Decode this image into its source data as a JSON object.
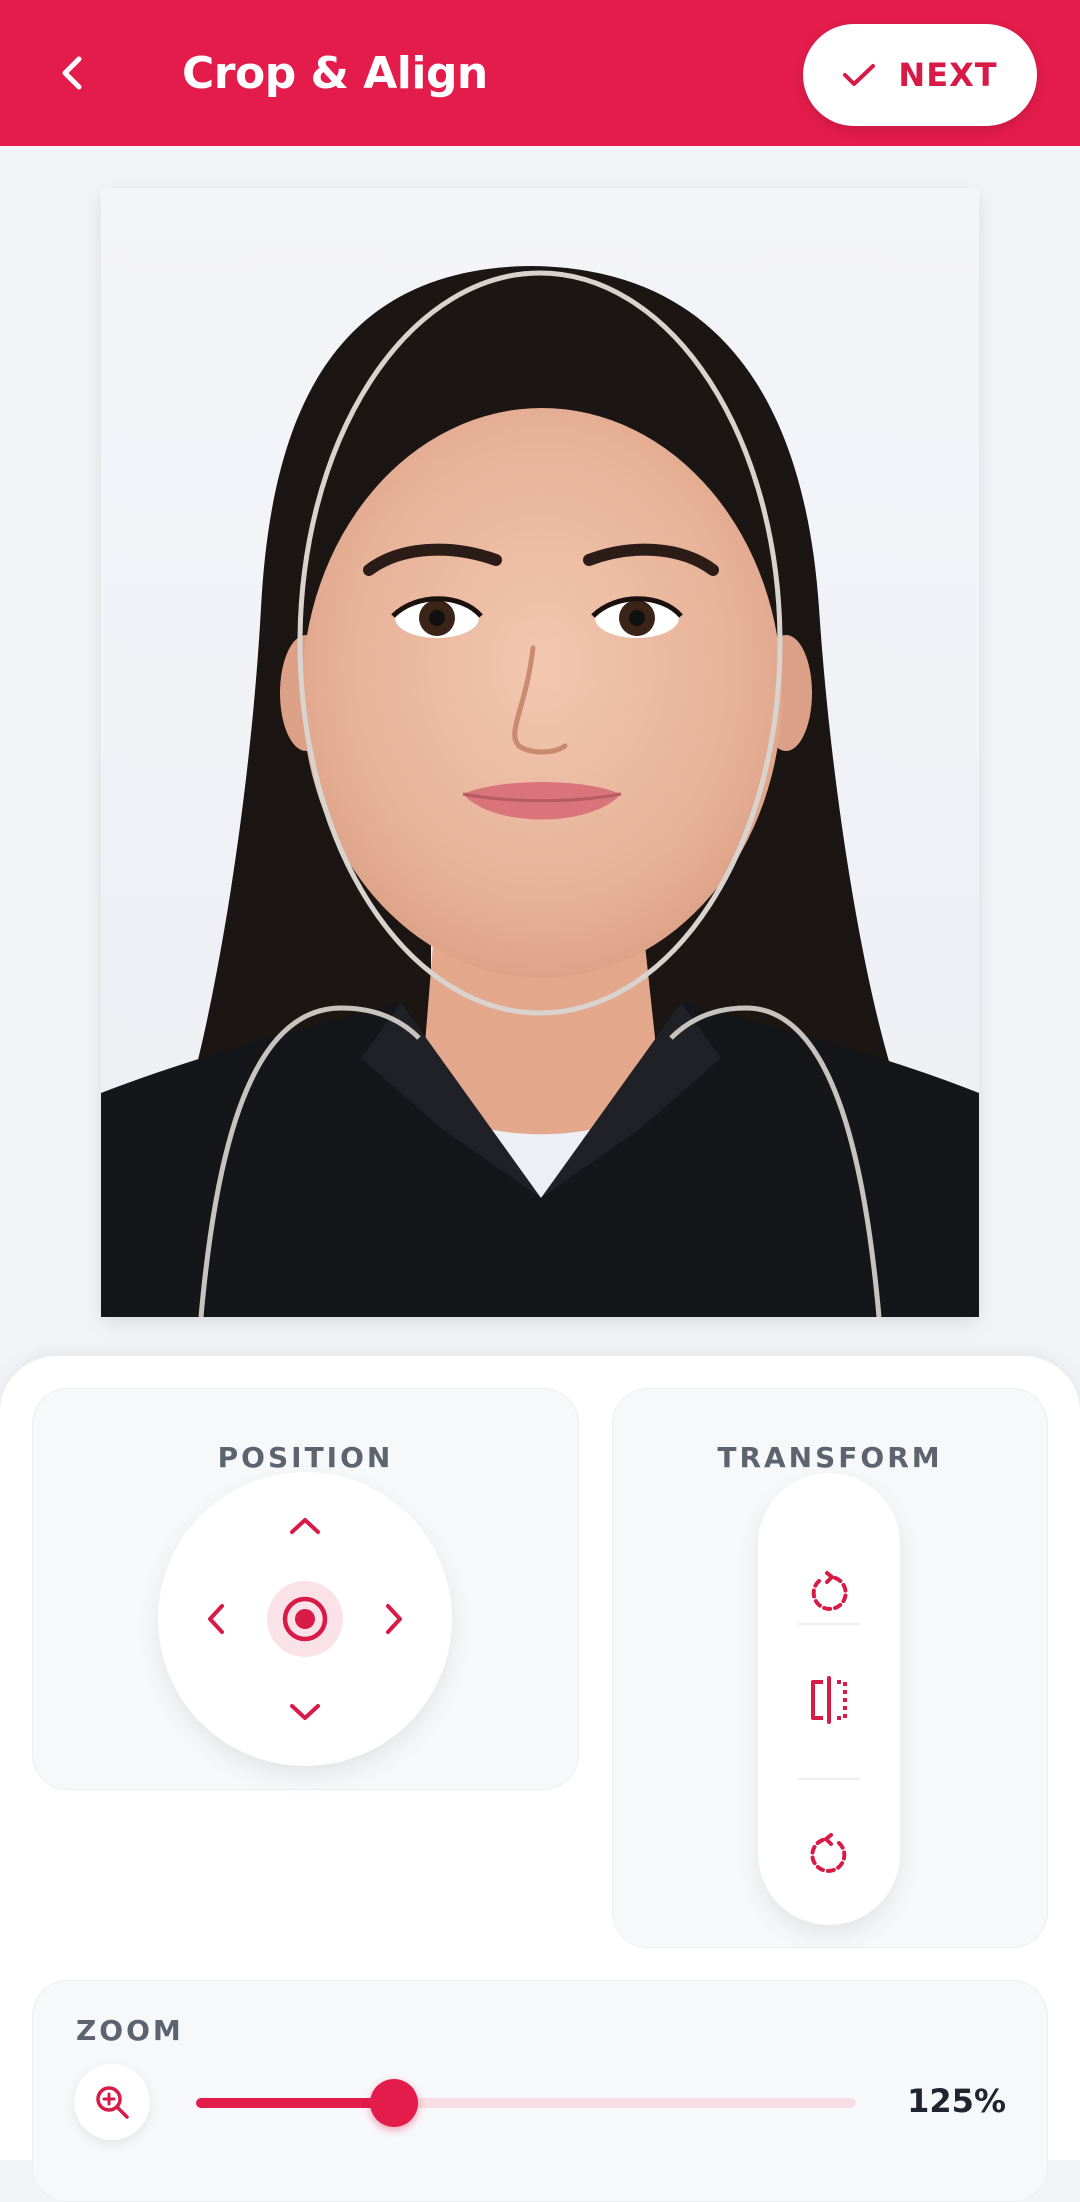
{
  "app_bar": {
    "title": "Crop & Align",
    "back_icon": "chevron-left-icon",
    "next_label": "NEXT",
    "next_icon": "check-icon"
  },
  "colors": {
    "accent": "#e31c4b",
    "accent_light": "#fbe1e8",
    "card_bg": "#f7f8fa",
    "guide_line": "#d9d3cf"
  },
  "position": {
    "label": "POSITION",
    "icons": [
      "chevron-up-icon",
      "chevron-left-icon",
      "target-icon",
      "chevron-right-icon",
      "chevron-down-icon"
    ]
  },
  "transform": {
    "label": "TRANSFORM",
    "icons": [
      "rotate-left-icon",
      "flip-horizontal-icon",
      "rotate-right-icon"
    ]
  },
  "zoom": {
    "label": "ZOOM",
    "icon": "zoom-in-icon",
    "value": "125%",
    "level": 0.3
  }
}
